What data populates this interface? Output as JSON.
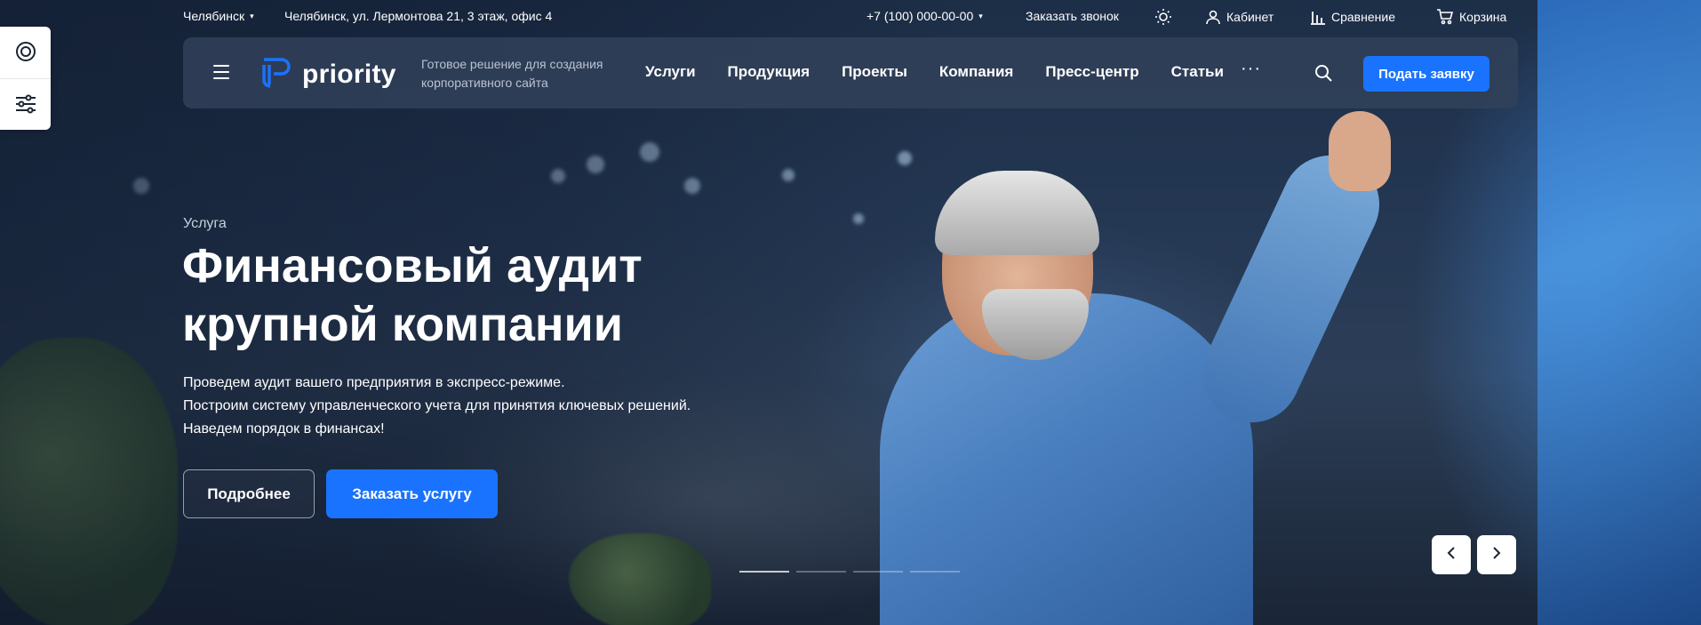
{
  "topbar": {
    "city": "Челябинск",
    "address": "Челябинск, ул. Лермонтова 21, 3 этаж, офис 4",
    "phone": "+7 (100) 000-00-00",
    "callback": "Заказать звонок",
    "cabinet": "Кабинет",
    "compare": "Сравнение",
    "cart": "Корзина"
  },
  "header": {
    "logo_text": "priority",
    "tagline": "Готовое решение для создания корпоративного сайта",
    "nav": [
      "Услуги",
      "Продукция",
      "Проекты",
      "Компания",
      "Пресс-центр",
      "Статьи"
    ],
    "more": "···",
    "cta": "Подать заявку"
  },
  "hero": {
    "eyebrow": "Услуга",
    "title_line1": "Финансовый аудит",
    "title_line2": "крупной компании",
    "desc": [
      "Проведем аудит вашего предприятия в экспресс-режиме.",
      "Построим систему управленческого учета для принятия ключевых решений.",
      "Наведем порядок в финансах!"
    ],
    "btn_more": "Подробнее",
    "btn_order": "Заказать услугу"
  },
  "slider": {
    "slides_total": 4,
    "active_slide": 1
  },
  "colors": {
    "accent": "#1a73ff",
    "header_bg": "#32425a"
  },
  "icons": {
    "side_top": "contrast-icon",
    "side_bottom": "settings-sliders-icon",
    "theme": "sun-icon",
    "cabinet": "user-icon",
    "compare": "chart-bars-icon",
    "cart": "cart-icon",
    "search": "search-icon",
    "prev": "chevron-left-icon",
    "next": "chevron-right-icon"
  }
}
